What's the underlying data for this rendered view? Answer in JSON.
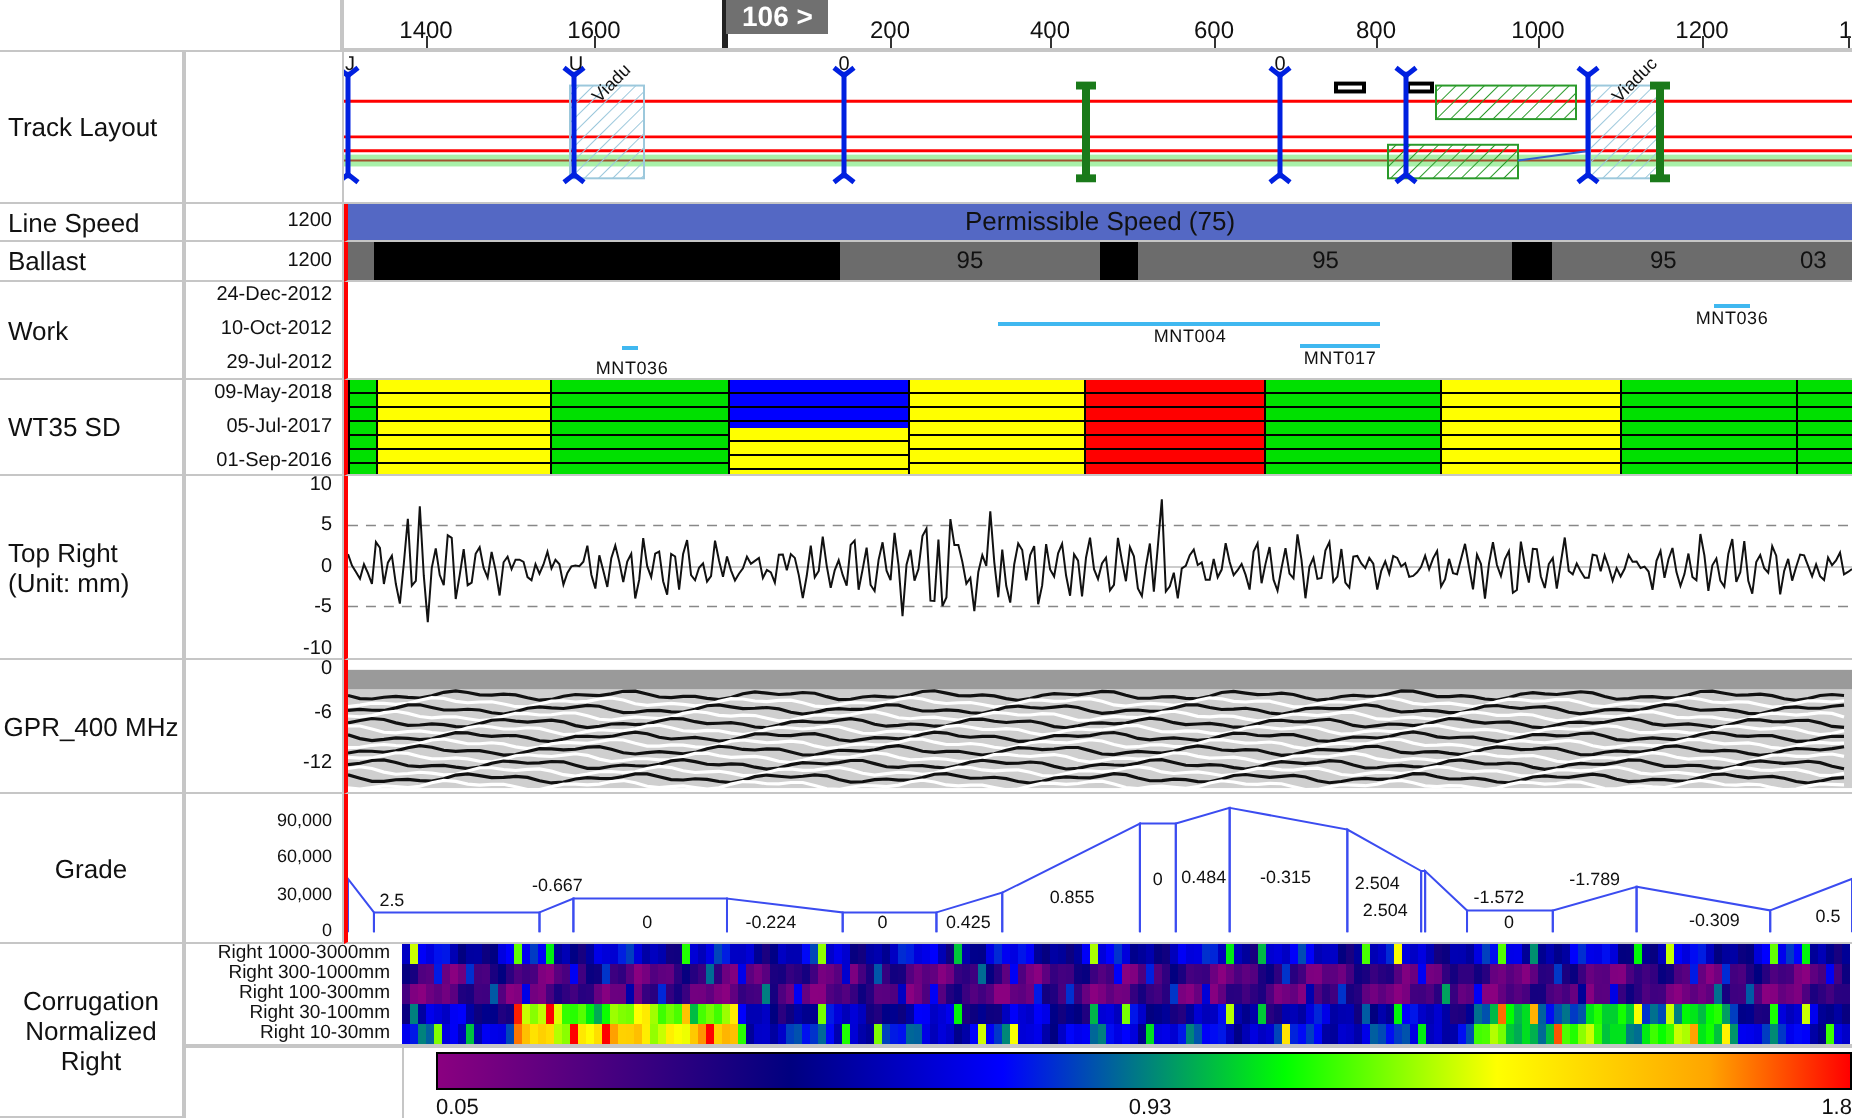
{
  "axis": {
    "ticks": [
      "1400",
      "1600",
      "200",
      "400",
      "600",
      "800",
      "1000",
      "1200",
      "1"
    ],
    "marker": "106 >"
  },
  "track_layout": {
    "label": "Track Layout",
    "marker_labels": [
      "J",
      "U",
      "0",
      "0"
    ],
    "viaduct_labels": [
      "Viadu",
      "Viaduc"
    ]
  },
  "line_speed": {
    "label": "Line Speed",
    "axis_label": "1200",
    "bar_text": "Permissible Speed (75)"
  },
  "ballast": {
    "label": "Ballast",
    "axis_label": "1200",
    "segments": [
      {
        "kind": "gap"
      },
      {
        "kind": "fill"
      },
      {
        "kind": "gap",
        "text": "95"
      },
      {
        "kind": "fill"
      },
      {
        "kind": "gap",
        "text": "95"
      },
      {
        "kind": "fill"
      },
      {
        "kind": "gap",
        "text": "95"
      },
      {
        "kind": "gap",
        "text": "03"
      }
    ]
  },
  "work": {
    "label": "Work",
    "dates": [
      "24-Dec-2012",
      "10-Oct-2012",
      "29-Jul-2012"
    ],
    "items": [
      {
        "label": "MNT036"
      },
      {
        "label": "MNT004"
      },
      {
        "label": "MNT017"
      },
      {
        "label": "MNT036"
      }
    ]
  },
  "wt35": {
    "label": "WT35 SD",
    "dates": [
      "09-May-2018",
      "05-Jul-2017",
      "01-Sep-2016"
    ],
    "columns": [
      {
        "color": "#00e000"
      },
      {
        "color": "#ffff00"
      },
      {
        "color": "#00e000"
      },
      {
        "parts": [
          {
            "color": "#0000ff"
          },
          {
            "color": "#ffff00"
          }
        ]
      },
      {
        "color": "#ffff00"
      },
      {
        "color": "#ff0000"
      },
      {
        "color": "#00e000"
      },
      {
        "color": "#ffff00"
      },
      {
        "color": "#00e000"
      },
      {
        "color": "#00e000"
      }
    ]
  },
  "top_right": {
    "label": "Top Right (Unit: mm)",
    "axis_labels": [
      "10",
      "5",
      "0",
      "-5",
      "-10"
    ]
  },
  "gpr": {
    "label": "GPR_400 MHz",
    "axis_labels": [
      "0",
      "-6",
      "-12"
    ]
  },
  "grade": {
    "label": "Grade",
    "axis_labels": [
      "90,000",
      "60,000",
      "30,000",
      "0"
    ],
    "grade_labels": [
      "2.5",
      "-0.667",
      "0",
      "-0.224",
      "0",
      "0.425",
      "0.855",
      "0",
      "0.484",
      "-0.315",
      "2.504",
      "2.504",
      "-1.572",
      "0",
      "-1.789",
      "-0.309",
      "0.5"
    ]
  },
  "corrugation": {
    "label": "Corrugation Normalized Right",
    "bands": [
      "Right 1000-3000mm",
      "Right 300-1000mm",
      "Right 100-300mm",
      "Right 30-100mm",
      "Right 10-30mm"
    ],
    "scale_labels": [
      "0.05",
      "0.93",
      "1.8"
    ]
  }
}
